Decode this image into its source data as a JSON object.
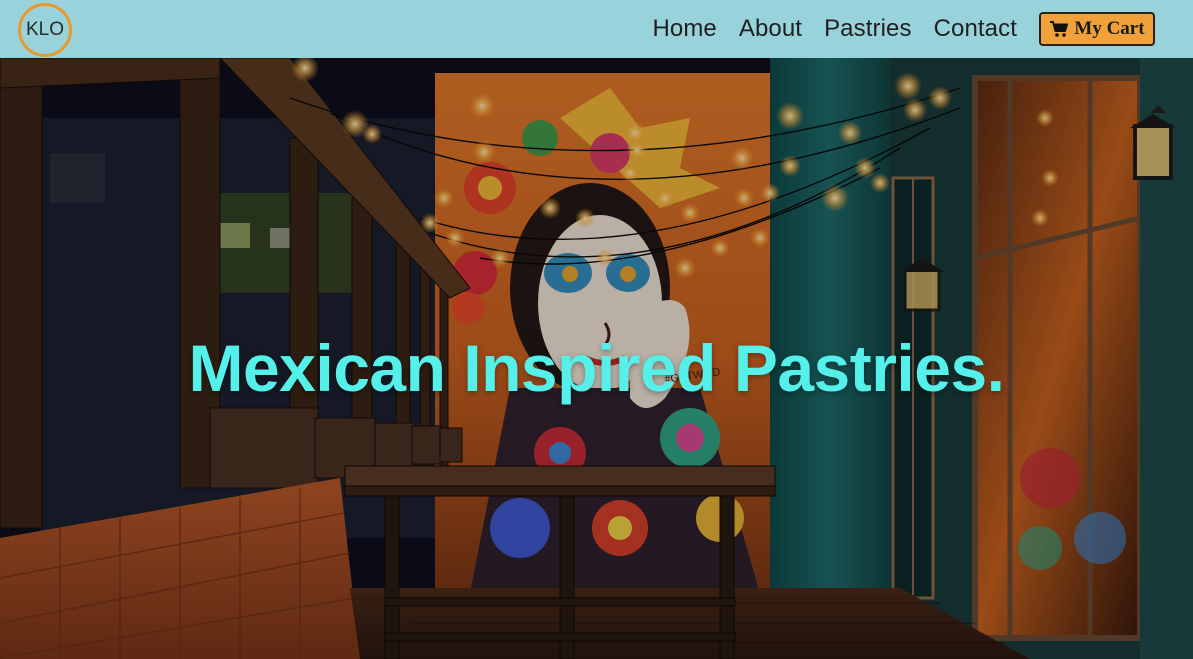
{
  "brand": {
    "logo_text": "KLO"
  },
  "nav": {
    "items": [
      {
        "label": "Home"
      },
      {
        "label": "About"
      },
      {
        "label": "Pastries"
      },
      {
        "label": "Contact"
      }
    ],
    "cart_label": "My Cart"
  },
  "hero": {
    "title": "Mexican Inspired Pastries.",
    "mural_tag": "#GETWILD"
  },
  "colors": {
    "navbar_bg": "#98d3dc",
    "logo_ring": "#e8992c",
    "cart_bg": "#f0a13a",
    "hero_title": "#55f0ea"
  }
}
